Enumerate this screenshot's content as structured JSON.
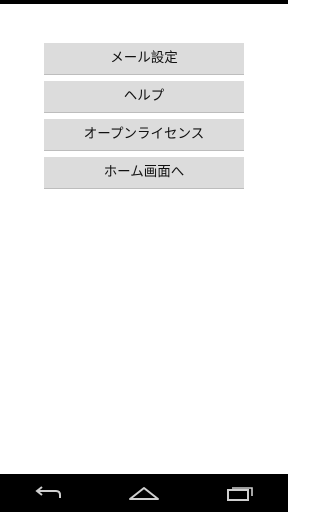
{
  "menu": {
    "items": [
      {
        "label": "メール設定"
      },
      {
        "label": "ヘルプ"
      },
      {
        "label": "オープンライセンス"
      },
      {
        "label": "ホーム画面へ"
      }
    ]
  },
  "nav": {
    "back_icon": "back-arrow-icon",
    "home_icon": "home-icon",
    "recents_icon": "recent-apps-icon"
  },
  "colors": {
    "button_bg": "#dcdcdc",
    "nav_bg": "#000000",
    "nav_icon": "#cfcfcf"
  }
}
